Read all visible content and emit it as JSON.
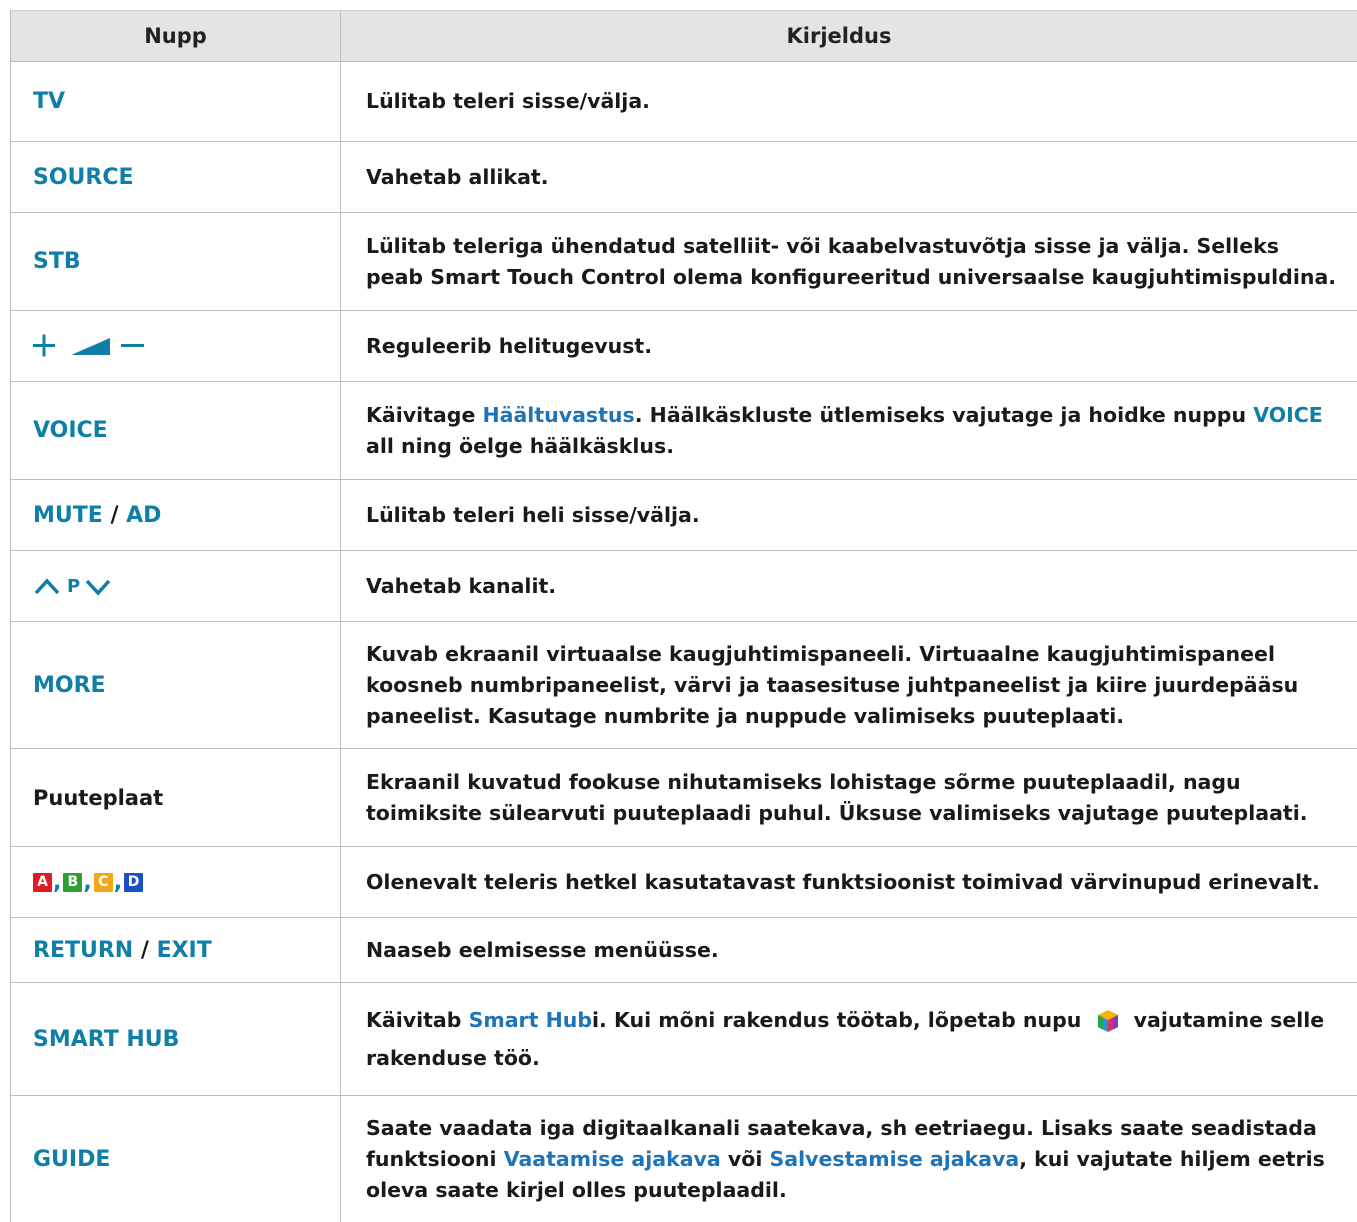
{
  "header": {
    "col1": "Nupp",
    "col2": "Kirjeldus"
  },
  "rows": {
    "tv": {
      "key": "TV",
      "desc": "Lülitab teleri sisse/välja."
    },
    "source": {
      "key": "SOURCE",
      "desc": "Vahetab allikat."
    },
    "stb": {
      "key": "STB",
      "desc": "Lülitab teleriga ühendatud satelliit- või kaabelvastuvõtja sisse ja välja. Selleks peab Smart Touch Control olema konfigureeritud universaalse kaugjuhtimispuldina."
    },
    "volume": {
      "key_icons": [
        "plus-icon",
        "volume-wedge-icon",
        "minus-icon"
      ],
      "desc": "Reguleerib helitugevust."
    },
    "voice": {
      "key": "VOICE",
      "desc_1": "Käivitage ",
      "desc_link": "Häältuvastus",
      "desc_2": ". Häälkäskluste ütlemiseks vajutage ja hoidke nuppu ",
      "desc_kw": "VOICE",
      "desc_3": "  all ning öelge häälkäsklus."
    },
    "mute": {
      "key_a": "MUTE",
      "slash": " / ",
      "key_b": "AD",
      "desc": "Lülitab teleri heli sisse/välja."
    },
    "channel": {
      "key_icons": [
        "chevron-up-icon",
        "chevron-down-icon"
      ],
      "key_mid": "P",
      "desc": "Vahetab kanalit."
    },
    "more": {
      "key": "MORE",
      "desc": "Kuvab ekraanil virtuaalse kaugjuhtimispaneeli. Virtuaalne kaugjuhtimispaneel koosneb numbripaneelist, värvi ja taasesituse juhtpaneelist ja kiire juurdepääsu paneelist. Kasutage numbrite ja nuppude valimiseks puuteplaati."
    },
    "touchpad": {
      "key": "Puuteplaat",
      "desc": "Ekraanil kuvatud fookuse nihutamiseks lohistage sõrme puuteplaadil, nagu toimiksite sülearvuti puuteplaadi puhul. Üksuse valimiseks vajutage puuteplaati."
    },
    "colors": {
      "buttons": [
        {
          "label": "A",
          "color": "#e01b24"
        },
        {
          "label": "B",
          "color": "#2e9e35"
        },
        {
          "label": "C",
          "color": "#f0a818"
        },
        {
          "label": "D",
          "color": "#1c4fc4"
        }
      ],
      "separator": ",",
      "desc": "Olenevalt teleris hetkel kasutatavast funktsioonist toimivad värvinupud erinevalt."
    },
    "return": {
      "key_a": "RETURN",
      "slash": " / ",
      "key_b": "EXIT",
      "desc": "Naaseb eelmisesse menüüsse."
    },
    "smarthub": {
      "key": "SMART HUB",
      "desc_1": "Käivitab ",
      "desc_link": "Smart Hub",
      "desc_2": "i. Kui mõni rakendus töötab, lõpetab nupu ",
      "desc_icon": "smart-hub-icon",
      "desc_3": " vajutamine selle rakenduse töö."
    },
    "guide": {
      "key": "GUIDE",
      "desc_1": "Saate vaadata iga digitaalkanali saatekava, sh eetriaegu. Lisaks saate seadistada funktsiooni ",
      "desc_link1": "Vaatamise ajakava",
      "desc_2": " või ",
      "desc_link2": "Salvestamise ajakava",
      "desc_3": ", kui vajutate hiljem eetris oleva saate kirjel olles puuteplaadil."
    }
  },
  "colors": {
    "keyword": "#0f7fa8",
    "link": "#1f74b8",
    "header_bg": "#e4e4e4",
    "grid": "#bdbdbd"
  }
}
